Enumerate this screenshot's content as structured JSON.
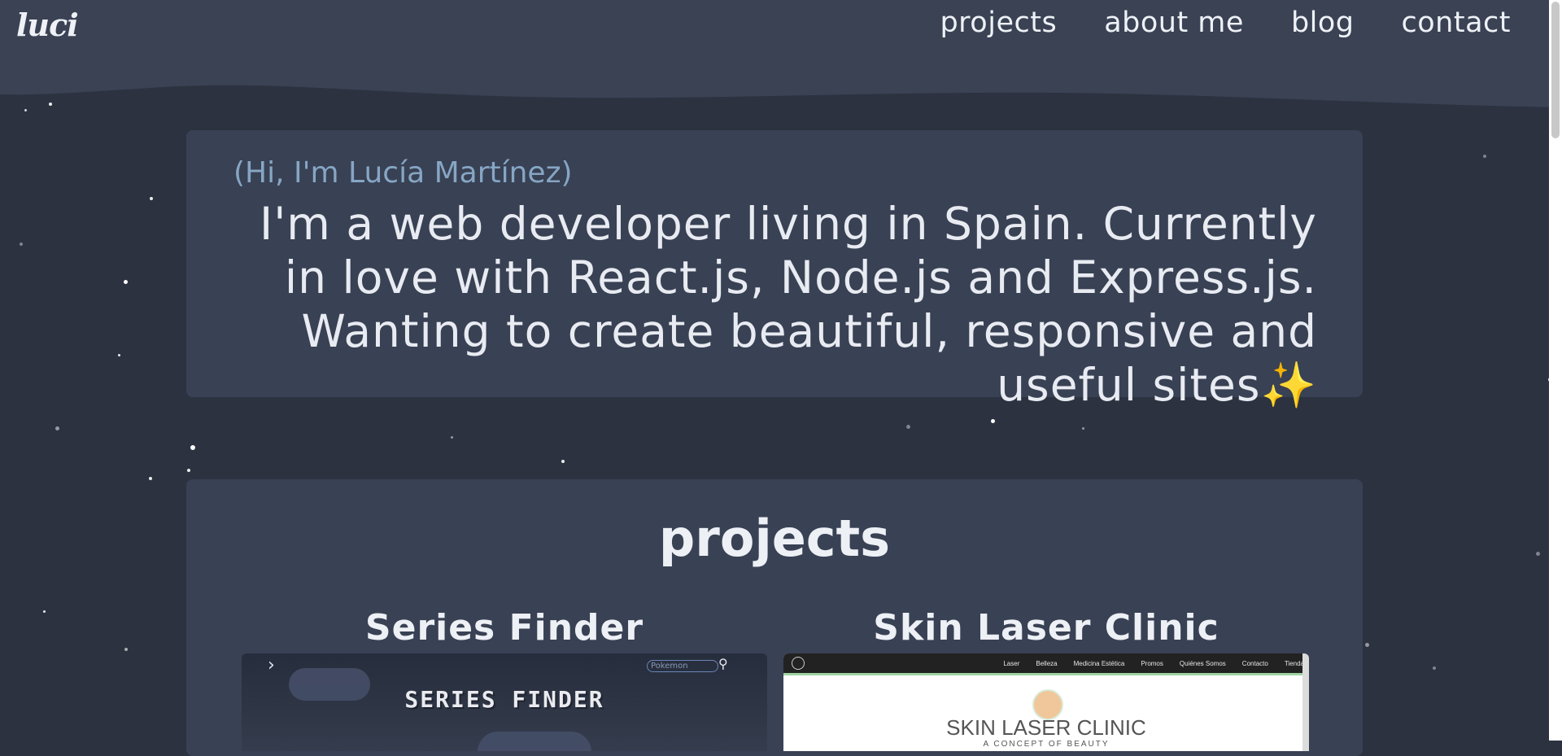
{
  "header": {
    "logo": "luci",
    "nav": [
      {
        "label": "projects"
      },
      {
        "label": "about me"
      },
      {
        "label": "blog"
      },
      {
        "label": "contact"
      }
    ]
  },
  "hero": {
    "greeting": "(Hi, I'm Lucía Martínez)",
    "intro": "I'm a web developer living in Spain. Currently in love with React.js, Node.js and Express.js. Wanting to create beautiful, responsive and useful sites✨"
  },
  "projects": {
    "heading": "projects",
    "items": [
      {
        "title": "Series Finder",
        "preview": {
          "logo_text": "SERIES FINDER",
          "search_placeholder": "Pokemon"
        }
      },
      {
        "title": "Skin Laser Clinic",
        "preview": {
          "nav": [
            "Laser",
            "Belleza",
            "Medicina Estética",
            "Promos",
            "Quiénes Somos",
            "Contacto",
            "Tienda"
          ],
          "brand": "SKIN LASER CLINIC",
          "tagline": "A CONCEPT OF BEAUTY"
        }
      }
    ]
  },
  "colors": {
    "background": "#2c3240",
    "header": "#3a4254",
    "panel": "#394154",
    "greeting": "#86a6c4",
    "text": "#e8ebf1"
  },
  "icons": [
    "chevron-right-icon",
    "magnifier-icon",
    "sparkles-icon"
  ]
}
